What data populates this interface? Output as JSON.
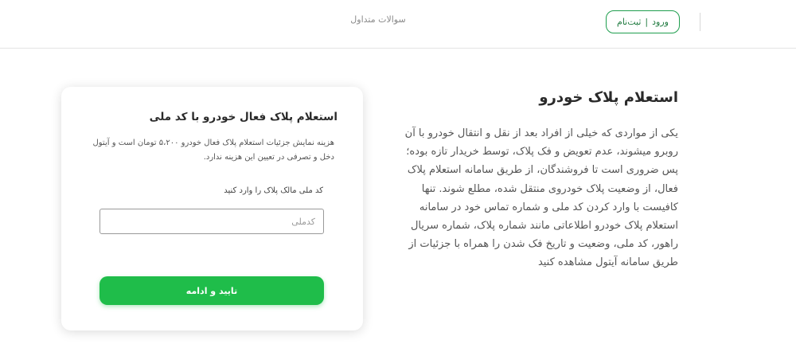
{
  "header": {
    "login_label": "ورود",
    "separator": "|",
    "register_label": "ثبت‌نام",
    "faq_label": "سوالات متداول"
  },
  "article": {
    "title": "استعلام پلاک خودرو",
    "body": "یکی از مواردی که خیلی از افراد بعد از نقل و انتقال خودرو با آن روبرو میشوند، عدم تعویض و فک پلاک، توسط خریدار تازه بوده؛ پس ضروری است تا فروشندگان، از طریق سامانه استعلام پلاک فعال، از وضعیت پلاک خودروی منتقل شده، مطلع شوند. تنها کافیست با وارد کردن کد ملی و شماره تماس خود در سامانه استعلام پلاک خودرو اطلاعاتی مانند شماره پلاک، شماره سریال راهور، کد ملی، وضعیت و تاریخ فک شدن را همراه با جزئیات از طریق سامانه آیتول مشاهده کنید"
  },
  "form": {
    "title": "استعلام پلاک فعال خودرو با کد ملی",
    "note": "هزینه نمایش جزئیات استعلام پلاک فعال خودرو ۵،۲۰۰ تومان است و آیتول دخل و تصرفی در تعیین این هزینه ندارد.",
    "field_label": "کد ملی مالک پلاک را وارد کنید",
    "national_id_placeholder": "کدملی",
    "national_id_value": "",
    "submit_label": "تایید و ادامه"
  },
  "colors": {
    "accent_green": "#1fbd4a",
    "outline_green": "#1f9e4e"
  }
}
